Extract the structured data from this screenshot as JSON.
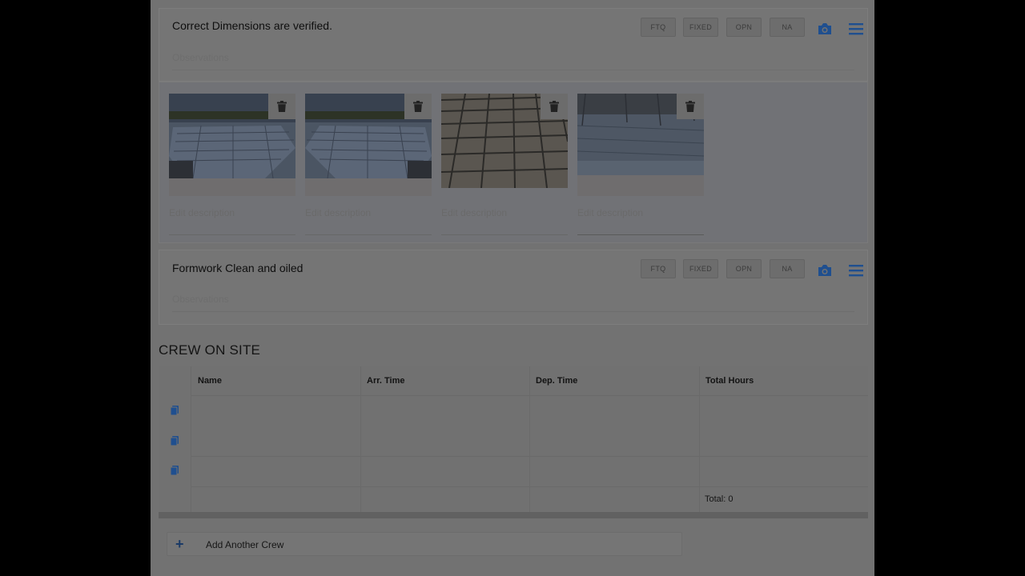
{
  "status_buttons": [
    "FTQ",
    "FIXED",
    "OPN",
    "NA"
  ],
  "items": [
    {
      "title": "Correct Dimensions are verified.",
      "observations_placeholder": "Observations"
    },
    {
      "title": "Formwork Clean and oiled",
      "observations_placeholder": "Observations"
    }
  ],
  "photos": [
    {
      "description_placeholder": "Edit description",
      "icon": "trash-icon"
    },
    {
      "description_placeholder": "Edit description",
      "icon": "trash-icon"
    },
    {
      "description_placeholder": "Edit description",
      "icon": "trash-icon"
    },
    {
      "description_placeholder": "Edit description",
      "icon": "trash-icon"
    }
  ],
  "crew": {
    "title": "CREW ON SITE",
    "columns": [
      "Name",
      "Arr. Time",
      "Dep. Time",
      "Total Hours"
    ],
    "rows": [
      {
        "name": "",
        "arr_time": "",
        "dep_time": "",
        "total_hours": ""
      },
      {
        "name": "",
        "arr_time": "",
        "dep_time": "",
        "total_hours": ""
      },
      {
        "name": "",
        "arr_time": "",
        "dep_time": "",
        "total_hours": ""
      }
    ],
    "total_label": "Total: 0",
    "add_button_label": "Add Another Crew",
    "add_icon": "+"
  },
  "colors": {
    "accent": "#1f4f8f",
    "overlay": "#000000"
  }
}
